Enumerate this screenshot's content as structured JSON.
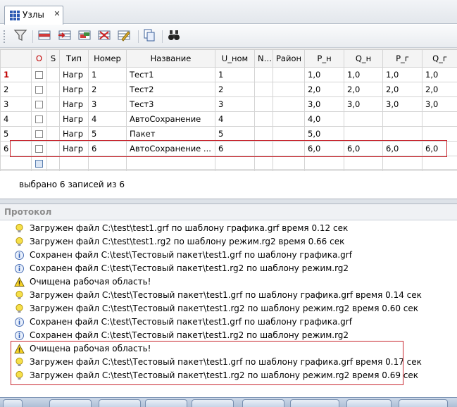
{
  "tab": {
    "title": "Узлы",
    "icon": "grid-icon"
  },
  "toolbar": {
    "buttons": [
      {
        "name": "filter-icon"
      },
      {
        "name": "insert-row-icon"
      },
      {
        "name": "append-row-icon"
      },
      {
        "name": "duplicate-row-icon"
      },
      {
        "name": "delete-row-icon"
      },
      {
        "name": "edit-table-icon"
      },
      {
        "name": "copy-icon"
      },
      {
        "name": "binoculars-icon"
      }
    ]
  },
  "grid": {
    "columns": [
      "О",
      "S",
      "Тип",
      "Номер",
      "Название",
      "U_ном",
      "N...",
      "Район",
      "P_н",
      "Q_н",
      "P_г",
      "Q_г"
    ],
    "rows": [
      {
        "n": "1",
        "tip": "Нагр",
        "nomer": "1",
        "name": "Тест1",
        "unom": "1",
        "pn": "1,0",
        "qn": "1,0",
        "pg": "1,0",
        "qg": "1,0"
      },
      {
        "n": "2",
        "tip": "Нагр",
        "nomer": "2",
        "name": "Тест2",
        "unom": "2",
        "pn": "2,0",
        "qn": "2,0",
        "pg": "2,0",
        "qg": "2,0"
      },
      {
        "n": "3",
        "tip": "Нагр",
        "nomer": "3",
        "name": "Тест3",
        "unom": "3",
        "pn": "3,0",
        "qn": "3,0",
        "pg": "3,0",
        "qg": "3,0"
      },
      {
        "n": "4",
        "tip": "Нагр",
        "nomer": "4",
        "name": "АвтоСохранение",
        "unom": "4",
        "pn": "4,0",
        "qn": "",
        "pg": "",
        "qg": ""
      },
      {
        "n": "5",
        "tip": "Нагр",
        "nomer": "5",
        "name": "Пакет",
        "unom": "5",
        "pn": "5,0",
        "qn": "",
        "pg": "",
        "qg": ""
      },
      {
        "n": "6",
        "tip": "Нагр",
        "nomer": "6",
        "name": "АвтоСохранение ...",
        "unom": "6",
        "pn": "6,0",
        "qn": "6,0",
        "pg": "6,0",
        "qg": "6,0"
      }
    ],
    "status": "выбрано 6 записей из 6"
  },
  "protocol": {
    "title": "Протокол",
    "items": [
      {
        "icon": "bulb-icon",
        "text": "Загружен файл C:\\test\\test1.grf по шаблону графика.grf время 0.12 сек"
      },
      {
        "icon": "bulb-icon",
        "text": "Загружен файл C:\\test\\test1.rg2 по шаблону режим.rg2 время 0.66 сек"
      },
      {
        "icon": "info-icon",
        "text": "Сохранен файл C:\\test\\Тестовый пакет\\test1.grf по шаблону графика.grf"
      },
      {
        "icon": "info-icon",
        "text": "Сохранен файл C:\\test\\Тестовый пакет\\test1.rg2 по шаблону режим.rg2"
      },
      {
        "icon": "warning-icon",
        "text": "Очищена рабочая область!"
      },
      {
        "icon": "bulb-icon",
        "text": "Загружен файл C:\\test\\Тестовый пакет\\test1.grf по шаблону графика.grf время 0.14 сек"
      },
      {
        "icon": "bulb-icon",
        "text": "Загружен файл C:\\test\\Тестовый пакет\\test1.rg2 по шаблону режим.rg2 время 0.60 сек"
      },
      {
        "icon": "info-icon",
        "text": "Сохранен файл C:\\test\\Тестовый пакет\\test1.grf по шаблону графика.grf"
      },
      {
        "icon": "info-icon",
        "text": "Сохранен файл C:\\test\\Тестовый пакет\\test1.rg2 по шаблону режим.rg2"
      },
      {
        "icon": "warning-icon",
        "text": "Очищена рабочая область!"
      },
      {
        "icon": "bulb-icon",
        "text": "Загружен файл C:\\test\\Тестовый пакет\\test1.grf по шаблону графика.grf время 0.17 сек"
      },
      {
        "icon": "bulb-icon",
        "text": "Загружен файл C:\\test\\Тестовый пакет\\test1.rg2 по шаблону режим.rg2 время 0.69 сек"
      }
    ]
  },
  "colors": {
    "highlight": "#c8262e",
    "accent": "#2c5bb3",
    "header_red": "#c00000"
  }
}
